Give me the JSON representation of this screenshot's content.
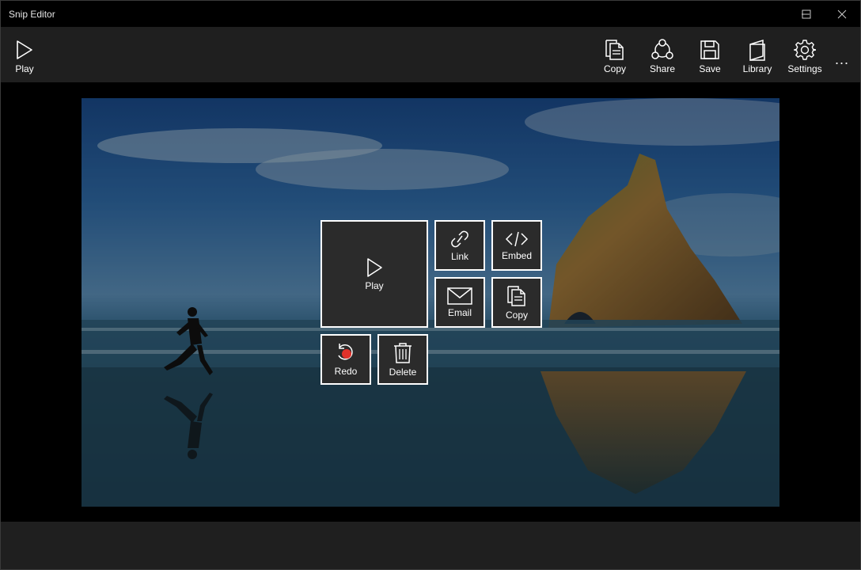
{
  "window": {
    "title": "Snip Editor"
  },
  "toolbar": {
    "play_label": "Play",
    "copy_label": "Copy",
    "share_label": "Share",
    "save_label": "Save",
    "library_label": "Library",
    "settings_label": "Settings",
    "more_label": "..."
  },
  "overlay": {
    "play_label": "Play",
    "link_label": "Link",
    "embed_label": "Embed",
    "email_label": "Email",
    "copy_label": "Copy",
    "redo_label": "Redo",
    "delete_label": "Delete"
  },
  "icons": {
    "play": "play-icon",
    "copy": "copy-icon",
    "share": "share-icon",
    "save": "save-icon",
    "library": "library-icon",
    "settings": "gear-icon",
    "link": "link-icon",
    "embed": "code-icon",
    "email": "mail-icon",
    "redo": "redo-icon",
    "delete": "trash-icon"
  },
  "colors": {
    "toolbar_bg": "#1f1f1f",
    "tile_bg": "#2b2b2b",
    "record_dot": "#e0312a"
  }
}
